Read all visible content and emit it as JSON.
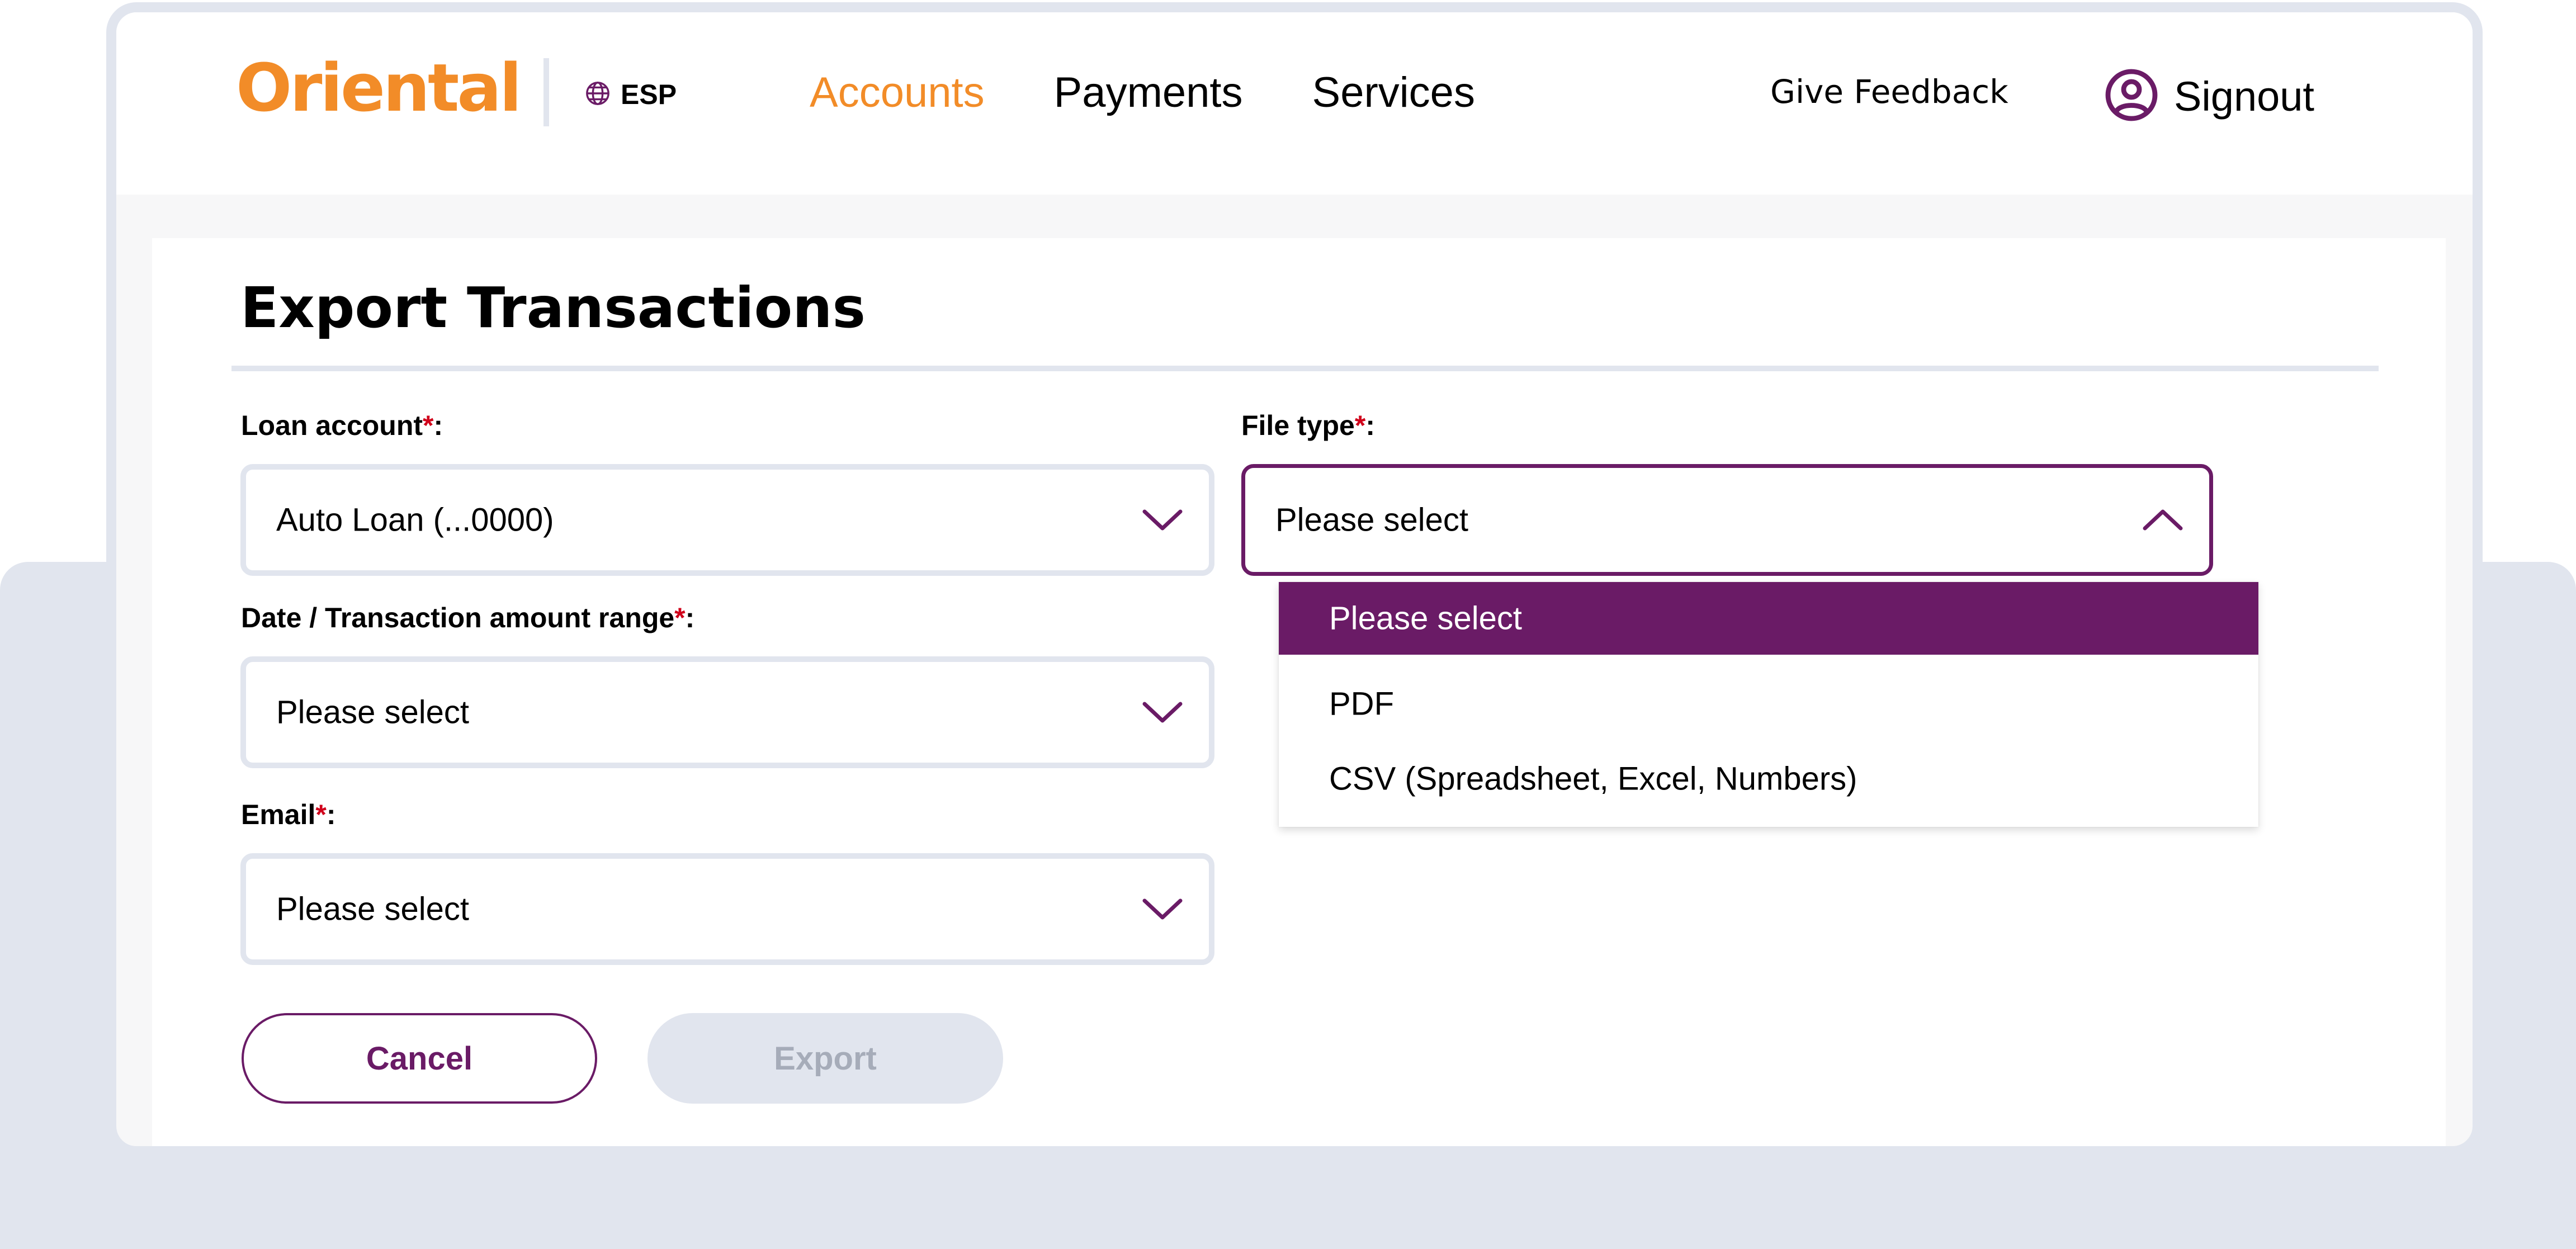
{
  "brand": {
    "logo_text": "Oriental",
    "accent_color": "#f28c28",
    "primary_color": "#6a1b66"
  },
  "header": {
    "language_label": "ESP",
    "language_icon": "globe-icon",
    "nav": [
      {
        "label": "Accounts",
        "active": true
      },
      {
        "label": "Payments",
        "active": false
      },
      {
        "label": "Services",
        "active": false
      }
    ],
    "feedback_label": "Give Feedback",
    "signout_label": "Signout",
    "signout_icon": "user-circle-icon"
  },
  "page": {
    "title": "Export Transactions"
  },
  "form": {
    "required_mark": "*",
    "loan_account": {
      "label": "Loan account",
      "suffix": ":",
      "value": "Auto Loan (...0000)"
    },
    "date_range": {
      "label": "Date / Transaction amount range",
      "suffix": ":",
      "value": "Please select"
    },
    "email": {
      "label": "Email",
      "suffix": ":",
      "value": "Please select"
    },
    "file_type": {
      "label": "File type",
      "suffix": ":",
      "value": "Please select",
      "open": true,
      "options": [
        {
          "label": "Please select",
          "selected": true
        },
        {
          "label": "PDF",
          "selected": false
        },
        {
          "label": "CSV (Spreadsheet, Excel, Numbers)",
          "selected": false
        }
      ]
    }
  },
  "actions": {
    "cancel_label": "Cancel",
    "export_label": "Export",
    "export_disabled": true
  }
}
